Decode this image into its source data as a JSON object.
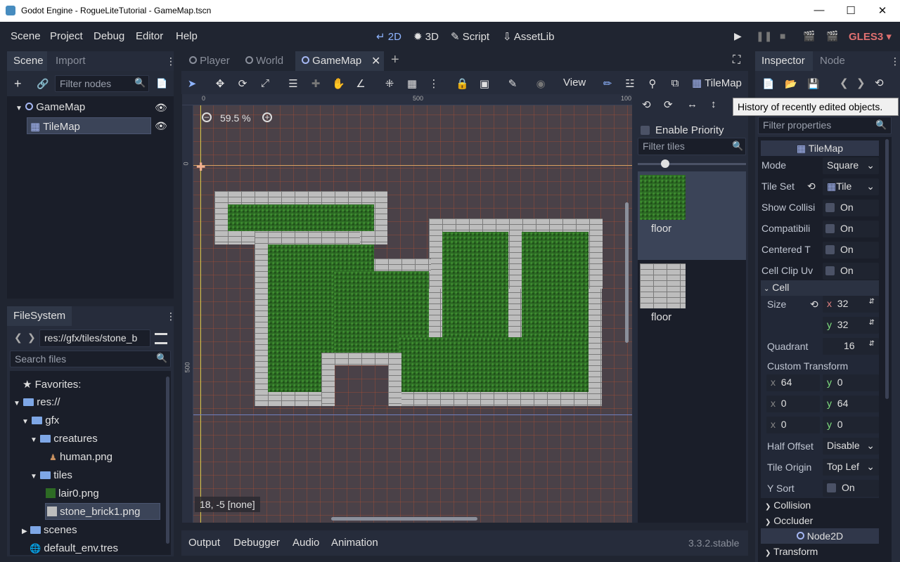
{
  "window": {
    "title": "Godot Engine - RogueLiteTutorial - GameMap.tscn"
  },
  "menubar": {
    "items": [
      "Scene",
      "Project",
      "Debug",
      "Editor",
      "Help"
    ],
    "modes": {
      "m2d": "2D",
      "m3d": "3D",
      "script": "Script",
      "assetlib": "AssetLib"
    },
    "renderer": "GLES3"
  },
  "scene_dock": {
    "tab_scene": "Scene",
    "tab_import": "Import",
    "filter_placeholder": "Filter nodes",
    "nodes": {
      "root": "GameMap",
      "child": "TileMap"
    }
  },
  "filesystem": {
    "title": "FileSystem",
    "path": "res://gfx/tiles/stone_b",
    "search_placeholder": "Search files",
    "items": {
      "favorites": "Favorites:",
      "res": "res://",
      "gfx": "gfx",
      "creatures": "creatures",
      "human": "human.png",
      "tiles": "tiles",
      "lair": "lair0.png",
      "stone": "stone_brick1.png",
      "scenes": "scenes",
      "env": "default_env.tres"
    }
  },
  "editor_tabs": {
    "player": "Player",
    "world": "World",
    "gamemap": "GameMap"
  },
  "toolbar": {
    "view": "View",
    "tilemap": "TileMap"
  },
  "viewport": {
    "zoom": "59.5 %",
    "status": "18, -5 [none]",
    "ruler": {
      "h0": "0",
      "h500": "500",
      "h1000": "100",
      "v0": "0",
      "v500": "500"
    }
  },
  "tile_palette": {
    "enable_priority": "Enable Priority",
    "filter_placeholder": "Filter tiles",
    "tile1": "floor",
    "tile2": "floor"
  },
  "inspector": {
    "tab_inspector": "Inspector",
    "tab_node": "Node",
    "tooltip": "History of recently edited objects.",
    "filter_placeholder": "Filter properties",
    "class_name": "TileMap",
    "mode_label": "Mode",
    "mode_value": "Square",
    "tileset_label": "Tile Set",
    "tileset_value": "Tile",
    "show_collision": "Show Collisi",
    "compat": "Compatibili",
    "centered": "Centered T",
    "clip": "Cell Clip Uv",
    "on": "On",
    "cell": "Cell",
    "size": "Size",
    "size_x": "32",
    "size_y": "32",
    "quadrant": "Quadrant",
    "quadrant_value": "16",
    "custom_transform": "Custom Transform",
    "t1x": "64",
    "t1y": "0",
    "t2x": "0",
    "t2y": "64",
    "t3x": "0",
    "t3y": "0",
    "half_offset": "Half Offset",
    "half_offset_value": "Disable",
    "tile_origin": "Tile Origin",
    "tile_origin_value": "Top Lef",
    "y_sort": "Y Sort",
    "collision": "Collision",
    "occluder": "Occluder",
    "node2d": "Node2D",
    "transform": "Transform"
  },
  "bottom": {
    "tabs": [
      "Output",
      "Debugger",
      "Audio",
      "Animation"
    ],
    "version": "3.3.2.stable"
  }
}
